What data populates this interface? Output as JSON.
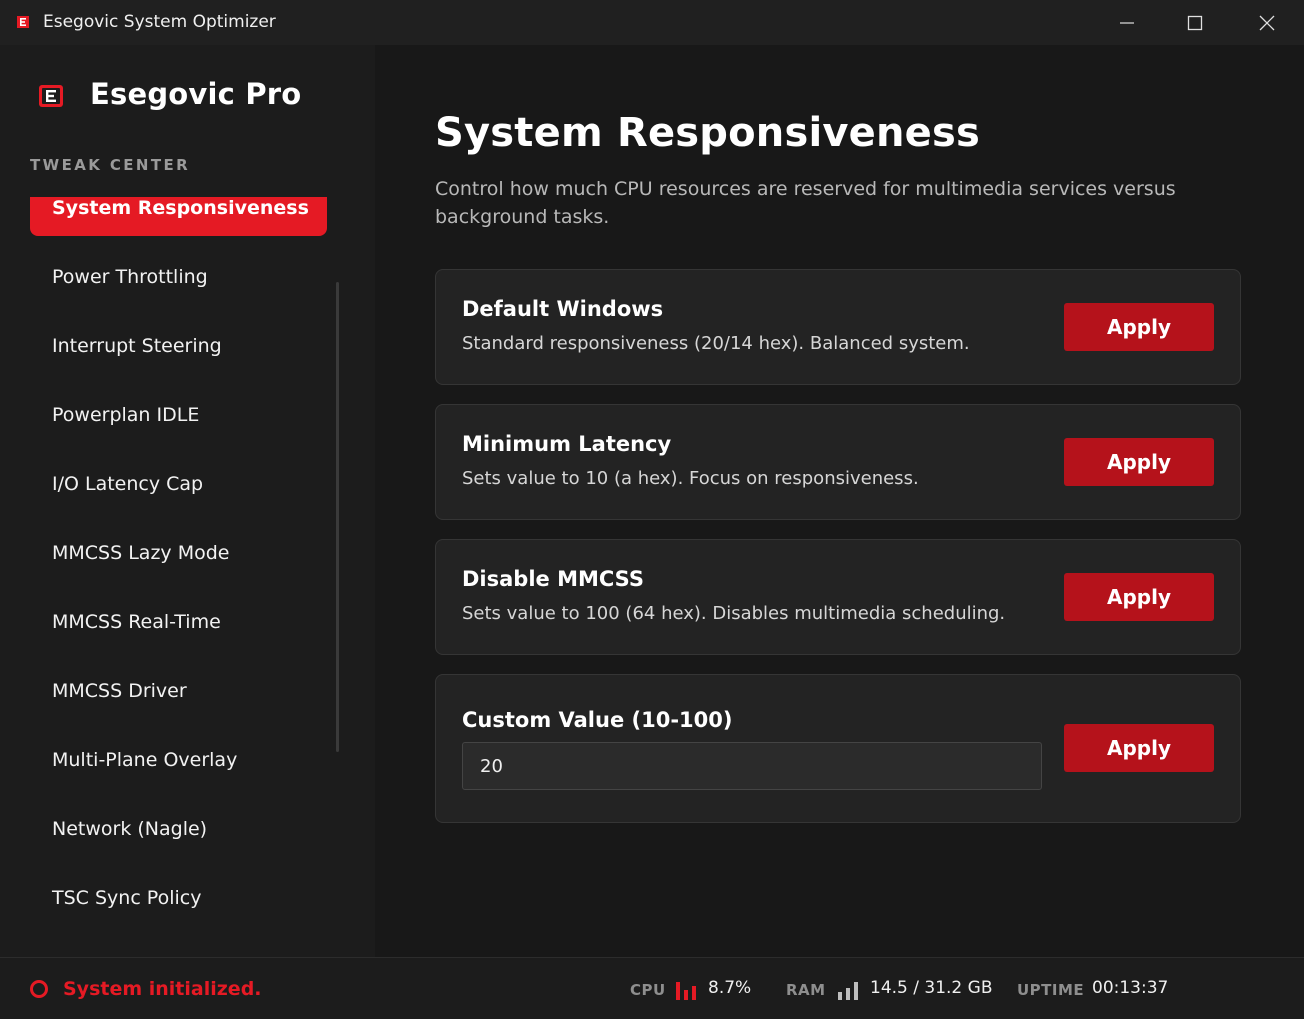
{
  "window": {
    "title": "Esegovic System Optimizer",
    "controls": {
      "minimize": "minimize-icon",
      "maximize": "maximize-icon",
      "close": "close-icon"
    }
  },
  "sidebar": {
    "brand": "Esegovic Pro",
    "section_label": "TWEAK CENTER",
    "items": [
      {
        "label": "System Responsiveness",
        "active": true
      },
      {
        "label": "Power Throttling",
        "active": false
      },
      {
        "label": "Interrupt Steering",
        "active": false
      },
      {
        "label": "Powerplan IDLE",
        "active": false
      },
      {
        "label": "I/O Latency Cap",
        "active": false
      },
      {
        "label": "MMCSS Lazy Mode",
        "active": false
      },
      {
        "label": "MMCSS Real-Time",
        "active": false
      },
      {
        "label": "MMCSS Driver",
        "active": false
      },
      {
        "label": "Multi-Plane Overlay",
        "active": false
      },
      {
        "label": "Network (Nagle)",
        "active": false
      },
      {
        "label": "TSC Sync Policy",
        "active": false
      }
    ]
  },
  "main": {
    "title": "System Responsiveness",
    "description": "Control how much CPU resources are reserved for multimedia services versus background tasks.",
    "cards": [
      {
        "title": "Default Windows",
        "description": "Standard responsiveness (20/14 hex). Balanced system.",
        "button": "Apply"
      },
      {
        "title": "Minimum Latency",
        "description": "Sets value to 10 (a hex). Focus on responsiveness.",
        "button": "Apply"
      },
      {
        "title": "Disable MMCSS",
        "description": "Sets value to 100 (64 hex). Disables multimedia scheduling.",
        "button": "Apply"
      },
      {
        "title": "Custom Value (10-100)",
        "input_value": "20",
        "button": "Apply"
      }
    ]
  },
  "statusbar": {
    "status": "System initialized.",
    "cpu_label": "CPU",
    "cpu_value": "8.7%",
    "ram_label": "RAM",
    "ram_value": "14.5 / 31.2 GB",
    "uptime_label": "UPTIME",
    "uptime_value": "00:13:37"
  },
  "colors": {
    "accent": "#e51a24",
    "button": "#b5121b",
    "background": "#181818",
    "card": "#232323"
  }
}
